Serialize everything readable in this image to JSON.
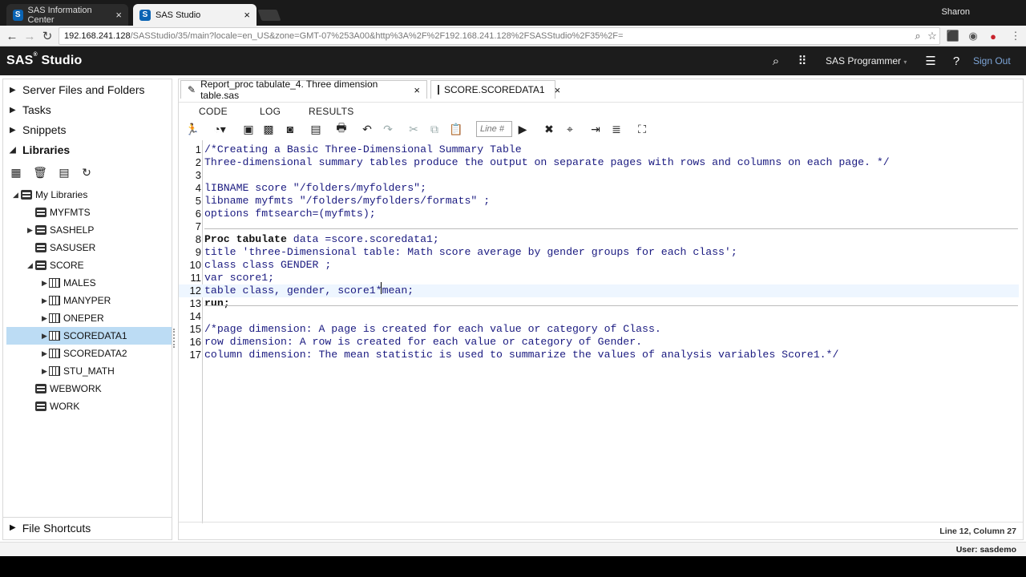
{
  "browser": {
    "tabs": [
      {
        "label": "SAS Information Center",
        "favicon": "S"
      },
      {
        "label": "SAS Studio",
        "favicon": "S"
      }
    ],
    "profile_name": "Sharon",
    "url_host": "192.168.241.128",
    "url_rest": "/SASStudio/35/main?locale=en_US&zone=GMT-07%253A00&http%3A%2F%2F192.168.241.128%2FSASStudio%2F35%2F="
  },
  "header": {
    "brand": "SAS",
    "brand_suffix": "Studio",
    "mode": "SAS Programmer",
    "sign_out": "Sign Out"
  },
  "sidebar": {
    "sections": [
      "Server Files and Folders",
      "Tasks",
      "Snippets",
      "Libraries"
    ],
    "tree": {
      "root": "My Libraries",
      "libraries": [
        "MYFMTS",
        "SASHELP",
        "SASUSER",
        "SCORE"
      ],
      "score_tables": [
        "MALES",
        "MANYPER",
        "ONEPER",
        "SCOREDATA1",
        "SCOREDATA2",
        "STU_MATH"
      ],
      "after": [
        "WEBWORK",
        "WORK"
      ]
    },
    "file_shortcuts": "File Shortcuts"
  },
  "editor": {
    "doc_tabs": [
      "Report_proc tabulate_4. Three dimension table.sas",
      "SCORE.SCOREDATA1"
    ],
    "sub_tabs": [
      "CODE",
      "LOG",
      "RESULTS"
    ],
    "line_placeholder": "Line #",
    "lines": [
      "/*Creating a Basic Three-Dimensional Summary Table",
      "Three-dimensional summary tables produce the output on separate pages with rows and columns on each page. */",
      "",
      "lIBNAME score \"/folders/myfolders\";",
      "libname myfmts \"/folders/myfolders/formats\" ;",
      "options fmtsearch=(myfmts);",
      "",
      "Proc tabulate data =score.scoredata1;",
      "title 'three-Dimensional table: Math score average by gender groups for each class';",
      "class class GENDER ;",
      "var score1;",
      "table class, gender, score1*mean;",
      "run;",
      "",
      "/*page dimension: A page is created for each value or category of Class.",
      "row dimension: A row is created for each value or category of Gender.",
      "column dimension: The mean statistic is used to summarize the values of analysis variables Score1.*/"
    ],
    "status": "Line 12, Column 27"
  },
  "footer": {
    "user": "User: sasdemo"
  }
}
